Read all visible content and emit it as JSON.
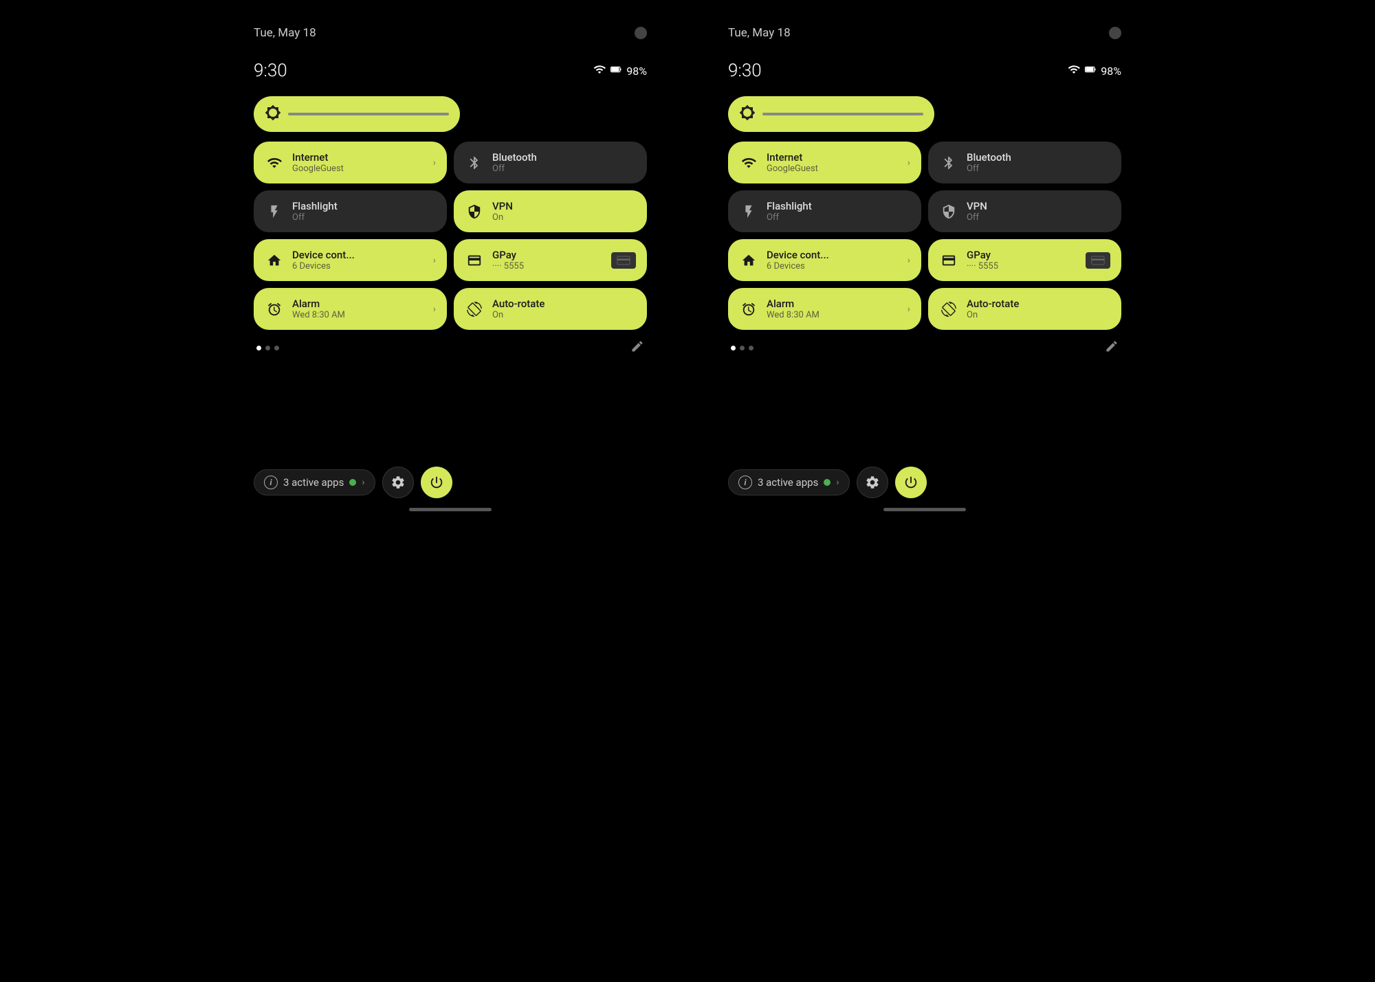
{
  "panels": [
    {
      "id": "left",
      "date": "Tue, May 18",
      "time": "9:30",
      "battery": "98%",
      "brightness": {
        "icon": "⚙"
      },
      "tiles": [
        {
          "id": "internet",
          "active": true,
          "icon": "wifi",
          "title": "Internet",
          "subtitle": "GoogleGuest",
          "hasChevron": true,
          "hasCard": false
        },
        {
          "id": "bluetooth",
          "active": false,
          "icon": "bluetooth",
          "title": "Bluetooth",
          "subtitle": "Off",
          "hasChevron": false,
          "hasCard": false
        },
        {
          "id": "flashlight",
          "active": false,
          "icon": "flashlight",
          "title": "Flashlight",
          "subtitle": "Off",
          "hasChevron": false,
          "hasCard": false
        },
        {
          "id": "vpn",
          "active": true,
          "icon": "vpn",
          "title": "VPN",
          "subtitle": "On",
          "hasChevron": false,
          "hasCard": false
        },
        {
          "id": "device-control",
          "active": true,
          "icon": "home",
          "title": "Device cont...",
          "subtitle": "6 Devices",
          "hasChevron": true,
          "hasCard": false
        },
        {
          "id": "gpay",
          "active": true,
          "icon": "card",
          "title": "GPay",
          "subtitle": "···· 5555",
          "hasChevron": false,
          "hasCard": true
        },
        {
          "id": "alarm",
          "active": true,
          "icon": "alarm",
          "title": "Alarm",
          "subtitle": "Wed 8:30 AM",
          "hasChevron": true,
          "hasCard": false
        },
        {
          "id": "autorotate",
          "active": true,
          "icon": "rotate",
          "title": "Auto-rotate",
          "subtitle": "On",
          "hasChevron": false,
          "hasCard": false
        }
      ],
      "bottomBar": {
        "activeAppsLabel": "3 active apps",
        "settingsIcon": "⚙",
        "powerIcon": "⏻"
      }
    },
    {
      "id": "right",
      "date": "Tue, May 18",
      "time": "9:30",
      "battery": "98%",
      "brightness": {
        "icon": "⚙"
      },
      "tiles": [
        {
          "id": "internet",
          "active": true,
          "icon": "wifi",
          "title": "Internet",
          "subtitle": "GoogleGuest",
          "hasChevron": true,
          "hasCard": false
        },
        {
          "id": "bluetooth",
          "active": false,
          "icon": "bluetooth",
          "title": "Bluetooth",
          "subtitle": "Off",
          "hasChevron": false,
          "hasCard": false
        },
        {
          "id": "flashlight",
          "active": false,
          "icon": "flashlight",
          "title": "Flashlight",
          "subtitle": "Off",
          "hasChevron": false,
          "hasCard": false
        },
        {
          "id": "vpn",
          "active": false,
          "icon": "vpn",
          "title": "VPN",
          "subtitle": "Off",
          "hasChevron": false,
          "hasCard": false
        },
        {
          "id": "device-control",
          "active": true,
          "icon": "home",
          "title": "Device cont...",
          "subtitle": "6 Devices",
          "hasChevron": true,
          "hasCard": false
        },
        {
          "id": "gpay",
          "active": true,
          "icon": "card",
          "title": "GPay",
          "subtitle": "···· 5555",
          "hasChevron": false,
          "hasCard": true
        },
        {
          "id": "alarm",
          "active": true,
          "icon": "alarm",
          "title": "Alarm",
          "subtitle": "Wed 8:30 AM",
          "hasChevron": true,
          "hasCard": false
        },
        {
          "id": "autorotate",
          "active": true,
          "icon": "rotate",
          "title": "Auto-rotate",
          "subtitle": "On",
          "hasChevron": false,
          "hasCard": false
        }
      ],
      "bottomBar": {
        "activeAppsLabel": "3 active apps",
        "settingsIcon": "⚙",
        "powerIcon": "⏻"
      }
    }
  ],
  "colors": {
    "accent": "#d4e85a",
    "tileActive": "#d4e85a",
    "tileInactive": "#2a2a2a",
    "background": "#000000"
  }
}
